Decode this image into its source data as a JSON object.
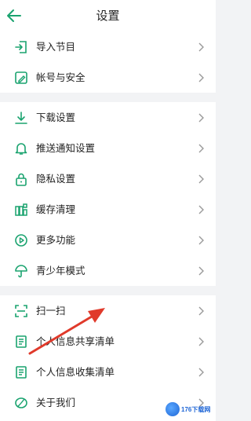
{
  "header": {
    "title": "设置",
    "back_icon": "back-arrow-icon"
  },
  "colors": {
    "accent": "#1aa36f",
    "background": "#f2f3f5",
    "card": "#ffffff",
    "annotation_arrow": "#e03a2b"
  },
  "group1": {
    "items": [
      {
        "label": "导入节目",
        "icon": "import-icon"
      },
      {
        "label": "帐号与安全",
        "icon": "account-security-icon"
      }
    ]
  },
  "group2": {
    "items": [
      {
        "label": "下载设置",
        "icon": "download-icon"
      },
      {
        "label": "推送通知设置",
        "icon": "bell-icon"
      },
      {
        "label": "隐私设置",
        "icon": "lock-icon"
      },
      {
        "label": "缓存清理",
        "icon": "cache-icon"
      },
      {
        "label": "更多功能",
        "icon": "play-circle-icon"
      },
      {
        "label": "青少年模式",
        "icon": "umbrella-icon"
      }
    ]
  },
  "group3": {
    "items": [
      {
        "label": "扫一扫",
        "icon": "scan-icon"
      },
      {
        "label": "个人信息共享清单",
        "icon": "list-icon"
      },
      {
        "label": "个人信息收集清单",
        "icon": "list-icon"
      },
      {
        "label": "关于我们",
        "icon": "about-icon"
      }
    ]
  },
  "watermark": {
    "text": "176下载网"
  }
}
